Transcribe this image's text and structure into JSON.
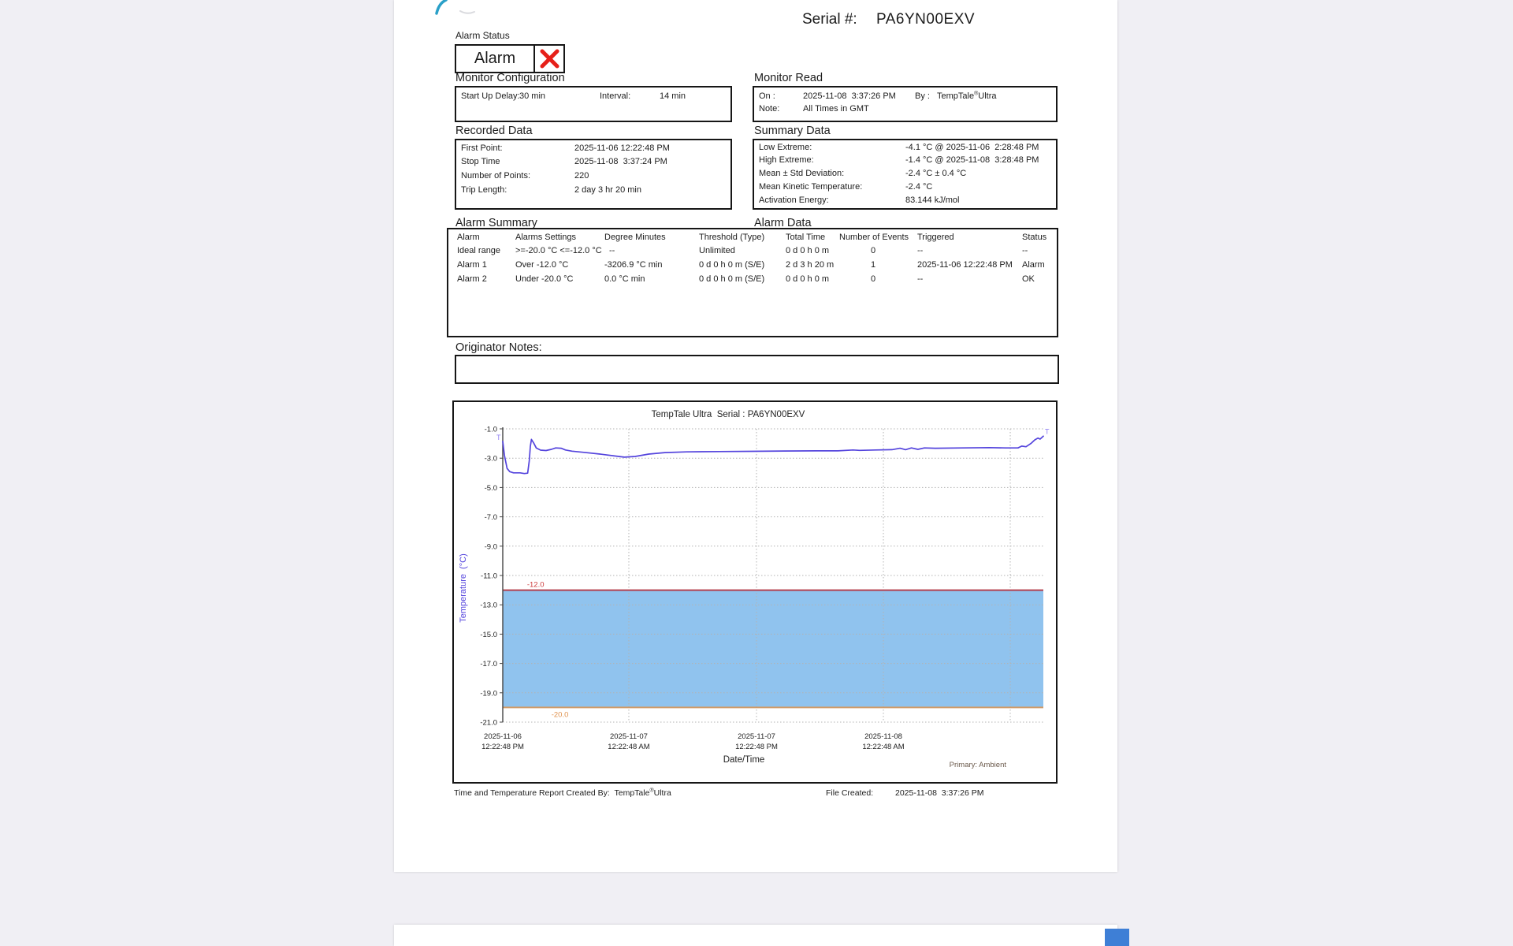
{
  "serial_section": {
    "label": "Serial #:",
    "value": "PA6YN00EXV"
  },
  "alarm_status": {
    "heading": "Alarm Status",
    "text": "Alarm"
  },
  "monitor_configuration": {
    "heading": "Monitor Configuration",
    "start_up_delay_label": "Start Up Delay:",
    "start_up_delay_value": "30 min",
    "interval_label": "Interval:",
    "interval_value": "14 min"
  },
  "monitor_read": {
    "heading": "Monitor Read",
    "on_label": "On :",
    "on_value": "2025-11-08  3:37:26 PM",
    "by_label": "By :",
    "by_brand": "TempTale",
    "reg": "®",
    "by_suffix": "Ultra",
    "note_label": "Note:",
    "note_value": "All Times in GMT"
  },
  "recorded_data": {
    "heading": "Recorded Data",
    "rows": [
      {
        "label": "First Point:",
        "value": "2025-11-06 12:22:48 PM"
      },
      {
        "label": "Stop Time",
        "value": "2025-11-08  3:37:24 PM"
      },
      {
        "label": "Number of Points:",
        "value": "220"
      },
      {
        "label": "Trip Length:",
        "value": "2 day 3 hr 20 min"
      }
    ]
  },
  "summary_data": {
    "heading": "Summary Data",
    "rows": [
      {
        "label": "Low Extreme:",
        "value": "-4.1 °C @ 2025-11-06  2:28:48 PM"
      },
      {
        "label": "High Extreme:",
        "value": "-1.4 °C @ 2025-11-08  3:28:48 PM"
      },
      {
        "label": "Mean ± Std Deviation:",
        "value": "-2.4 °C ± 0.4 °C"
      },
      {
        "label": "Mean Kinetic Temperature:",
        "value": "-2.4 °C"
      },
      {
        "label": "Activation Energy:",
        "value": "83.144 kJ/mol"
      }
    ]
  },
  "alarm_summary_heading": "Alarm Summary",
  "alarm_data_heading": "Alarm Data",
  "alarm_table": {
    "headers": [
      "Alarm",
      "Alarms Settings",
      "Degree Minutes",
      "Threshold (Type)",
      "Total Time",
      "Number of Events",
      "Triggered",
      "Status"
    ],
    "rows": [
      [
        "Ideal range",
        ">=-20.0 °C <=-12.0 °C",
        "--",
        "Unlimited",
        "0 d 0 h 0 m",
        "0",
        "--",
        "--"
      ],
      [
        "Alarm 1",
        "Over -12.0 °C",
        "-3206.9 °C min",
        "0 d 0 h 0 m (S/E)",
        "2 d 3 h 20 m",
        "1",
        "2025-11-06 12:22:48 PM",
        "Alarm"
      ],
      [
        "Alarm 2",
        "Under -20.0 °C",
        "0.0 °C min",
        "0 d 0 h 0 m (S/E)",
        "0 d 0 h 0 m",
        "0",
        "--",
        "OK"
      ]
    ]
  },
  "originator_notes_heading": "Originator Notes:",
  "footer": {
    "created_by_label": "Time and Temperature Report Created By:  ",
    "brand": "TempTale",
    "reg": "®",
    "brand_suffix": "Ultra",
    "file_created_label": "File Created:",
    "file_created_value": "2025-11-08  3:37:26 PM"
  },
  "colors": {
    "alarm_x": "#e62019",
    "swoosh": "#2aa0c8",
    "swoosh_faint": "#d9dade",
    "marker_blue": "#3e7fd6"
  },
  "chart_data": {
    "type": "line",
    "title": "TempTale Ultra  Serial : PA6YN00EXV",
    "xlabel": "Date/Time",
    "ylabel": "Temperature  (°C)",
    "legend": "Primary: Ambient",
    "ylim": [
      -21.0,
      -1.0
    ],
    "yticks": [
      -1,
      -3,
      -5,
      -7,
      -9,
      -11,
      -13,
      -15,
      -17,
      -19,
      -21
    ],
    "x_ticks": [
      {
        "frac": 0.0,
        "line1": "2025-11-06",
        "line2": "12:22:48 PM"
      },
      {
        "frac": 0.2332,
        "line1": "2025-11-07",
        "line2": "12:22:48 AM"
      },
      {
        "frac": 0.4694,
        "line1": "2025-11-07",
        "line2": "12:22:48 PM"
      },
      {
        "frac": 0.7041,
        "line1": "2025-11-08",
        "line2": "12:22:48 AM"
      }
    ],
    "x_grid_fracs": [
      0.2332,
      0.4694,
      0.7041,
      0.9388
    ],
    "ideal_range": {
      "upper": -12.0,
      "lower": -20.0,
      "upper_label": "-12.0",
      "lower_label": "-20.0"
    },
    "series": [
      {
        "name": "Primary: Ambient",
        "color": "#5444dd",
        "marker": "T",
        "points": [
          [
            0.0,
            -1.85
          ],
          [
            0.003,
            -2.8
          ],
          [
            0.008,
            -3.7
          ],
          [
            0.013,
            -3.92
          ],
          [
            0.02,
            -4.0
          ],
          [
            0.032,
            -4.0
          ],
          [
            0.04,
            -4.05
          ],
          [
            0.046,
            -4.02
          ],
          [
            0.049,
            -3.2
          ],
          [
            0.051,
            -2.2
          ],
          [
            0.053,
            -1.72
          ],
          [
            0.057,
            -1.95
          ],
          [
            0.062,
            -2.3
          ],
          [
            0.07,
            -2.45
          ],
          [
            0.08,
            -2.48
          ],
          [
            0.09,
            -2.4
          ],
          [
            0.098,
            -2.3
          ],
          [
            0.108,
            -2.32
          ],
          [
            0.116,
            -2.44
          ],
          [
            0.128,
            -2.52
          ],
          [
            0.15,
            -2.6
          ],
          [
            0.18,
            -2.72
          ],
          [
            0.21,
            -2.86
          ],
          [
            0.225,
            -2.93
          ],
          [
            0.245,
            -2.88
          ],
          [
            0.27,
            -2.72
          ],
          [
            0.3,
            -2.62
          ],
          [
            0.34,
            -2.57
          ],
          [
            0.4,
            -2.55
          ],
          [
            0.46,
            -2.53
          ],
          [
            0.52,
            -2.51
          ],
          [
            0.58,
            -2.5
          ],
          [
            0.62,
            -2.5
          ],
          [
            0.648,
            -2.44
          ],
          [
            0.66,
            -2.47
          ],
          [
            0.69,
            -2.44
          ],
          [
            0.72,
            -2.42
          ],
          [
            0.735,
            -2.32
          ],
          [
            0.745,
            -2.42
          ],
          [
            0.756,
            -2.3
          ],
          [
            0.768,
            -2.4
          ],
          [
            0.78,
            -2.3
          ],
          [
            0.8,
            -2.32
          ],
          [
            0.85,
            -2.3
          ],
          [
            0.9,
            -2.28
          ],
          [
            0.93,
            -2.3
          ],
          [
            0.953,
            -2.3
          ],
          [
            0.96,
            -2.18
          ],
          [
            0.968,
            -2.22
          ],
          [
            0.977,
            -2.0
          ],
          [
            0.984,
            -1.76
          ],
          [
            0.99,
            -1.63
          ],
          [
            0.994,
            -1.7
          ],
          [
            1.0,
            -1.5
          ]
        ]
      }
    ],
    "colors": {
      "band": "#90c3ee",
      "upper_line": "#b5404e",
      "upper_label": "#cc3b3b",
      "lower_line": "#d09a68",
      "lower_label": "#e0924e",
      "grid": "#b3b3b3",
      "axis": "#444444",
      "marker": "#8d7ef2",
      "legend_text": "#6b5a4c",
      "text": "#222222"
    }
  }
}
